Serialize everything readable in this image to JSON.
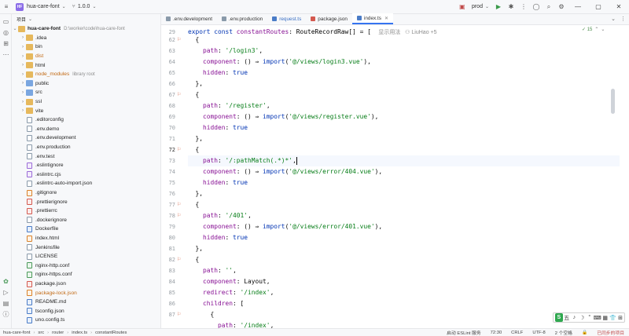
{
  "titlebar": {
    "app_badge": "HF",
    "project": "hua-care-font",
    "vcs_branch": "1.0.0",
    "run_config": "prod"
  },
  "project_panel": {
    "header": "项目",
    "root": {
      "name": "hua-care-font",
      "path": "D:\\worker\\code\\hua-care-font"
    },
    "items": [
      {
        "name": ".idea",
        "kind": "folder",
        "expandable": true,
        "color": "normal"
      },
      {
        "name": "bin",
        "kind": "folder",
        "expandable": true,
        "color": "normal"
      },
      {
        "name": "dist",
        "kind": "folder",
        "expandable": true,
        "color": "orange"
      },
      {
        "name": "html",
        "kind": "folder",
        "expandable": true,
        "color": "normal"
      },
      {
        "name": "node_modules",
        "hint": "library root",
        "kind": "folder",
        "expandable": true,
        "color": "orange"
      },
      {
        "name": "public",
        "kind": "folder-blue",
        "expandable": true,
        "color": "normal"
      },
      {
        "name": "src",
        "kind": "folder-blue",
        "expandable": true,
        "color": "normal"
      },
      {
        "name": "ssl",
        "kind": "folder",
        "expandable": true,
        "color": "normal"
      },
      {
        "name": "vite",
        "kind": "folder",
        "expandable": true,
        "color": "normal"
      },
      {
        "name": ".editorconfig",
        "kind": "file",
        "color": "normal"
      },
      {
        "name": ".env.demo",
        "kind": "file",
        "color": "normal"
      },
      {
        "name": ".env.development",
        "kind": "file",
        "color": "normal"
      },
      {
        "name": ".env.production",
        "kind": "file",
        "color": "normal"
      },
      {
        "name": ".env.test",
        "kind": "file",
        "color": "normal"
      },
      {
        "name": ".eslintignore",
        "kind": "file-purple",
        "color": "normal"
      },
      {
        "name": ".eslintrc.cjs",
        "kind": "file-purple",
        "color": "normal"
      },
      {
        "name": ".eslintrc-auto-import.json",
        "kind": "file",
        "color": "normal"
      },
      {
        "name": ".gitignore",
        "kind": "file-orange",
        "color": "normal"
      },
      {
        "name": ".prettierignore",
        "kind": "file-red",
        "color": "normal"
      },
      {
        "name": ".prettierrc",
        "kind": "file-red",
        "color": "normal"
      },
      {
        "name": ".dockerignore",
        "kind": "file",
        "color": "normal"
      },
      {
        "name": "Dockerfile",
        "kind": "file-blue",
        "color": "normal"
      },
      {
        "name": "index.html",
        "kind": "file-orange",
        "color": "normal"
      },
      {
        "name": "Jenkinsfile",
        "kind": "file",
        "color": "normal"
      },
      {
        "name": "LICENSE",
        "kind": "file",
        "color": "normal"
      },
      {
        "name": "nginx-http.conf",
        "kind": "file-green",
        "color": "normal"
      },
      {
        "name": "nginx-https.conf",
        "kind": "file-green",
        "color": "normal"
      },
      {
        "name": "package.json",
        "kind": "file-red",
        "color": "normal"
      },
      {
        "name": "package-lock.json",
        "kind": "file-orange",
        "color": "orange"
      },
      {
        "name": "README.md",
        "kind": "file-blue",
        "color": "normal"
      },
      {
        "name": "tsconfig.json",
        "kind": "file-blue",
        "color": "normal"
      },
      {
        "name": "uno.config.ts",
        "kind": "file-blue",
        "color": "normal"
      }
    ]
  },
  "tabs": [
    {
      "label": ".env.development",
      "color": "#8a9aaa",
      "active": false
    },
    {
      "label": ".env.production",
      "color": "#8a9aaa",
      "active": false
    },
    {
      "label": "request.ts",
      "color": "#4a7cc7",
      "active": false
    },
    {
      "label": "package.json",
      "color": "#d4594f",
      "active": false
    },
    {
      "label": "index.ts",
      "color": "#4a7cc7",
      "active": true
    }
  ],
  "editor": {
    "inspection": "✓ 15",
    "line_numbers": [
      "29",
      "62",
      "63",
      "64",
      "65",
      "66",
      "67",
      "68",
      "69",
      "70",
      "71",
      "72",
      "73",
      "74",
      "75",
      "76",
      "77",
      "78",
      "79",
      "80",
      "81",
      "82",
      "83",
      "84",
      "85",
      "86",
      "87"
    ],
    "current_line": "72",
    "header_hint": "显示用法",
    "author_hint": "LiuHao +5",
    "strings": {
      "login3_path": "'/login3'",
      "login3_view": "'@/views/login3.vue'",
      "register_path": "'/register'",
      "register_view": "'@/views/register.vue'",
      "pathmatch_path": "'/:pathMatch(.*)*'",
      "error404_view": "'@/views/error/404.vue'",
      "p401_path": "'/401'",
      "error401_view": "'@/views/error/401.vue'",
      "empty_path": "''",
      "index_redirect": "'/index'",
      "index_path": "'/index'"
    }
  },
  "statusbar": {
    "breadcrumb": [
      "hua-care-font",
      "src",
      "router",
      "index.ts",
      "constantRoutes"
    ],
    "eslint": "启动 ESLint 服务",
    "position": "72:30",
    "line_sep": "CRLF",
    "encoding": "UTF-8",
    "indent": "2 个空格",
    "shared": "已同步的项目"
  },
  "ime": {
    "logo": "S",
    "cells": [
      "五",
      "♪",
      "☽",
      "°",
      "⌨",
      "▦",
      "👕",
      "⊞"
    ]
  }
}
